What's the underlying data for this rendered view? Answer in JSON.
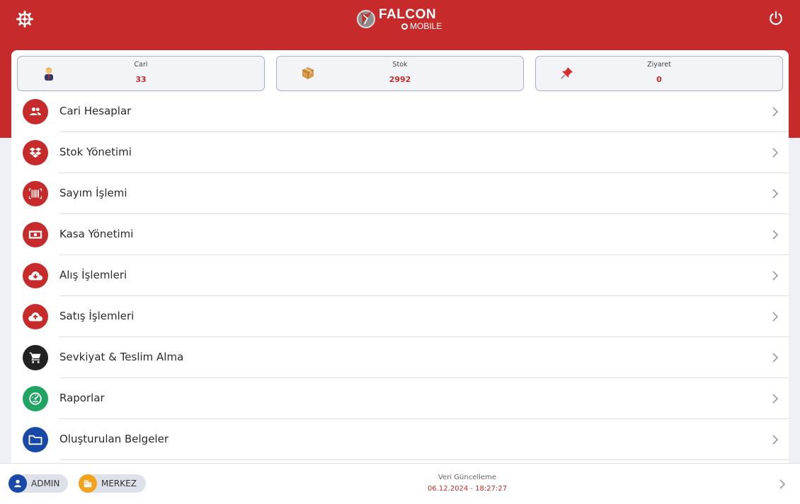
{
  "header": {
    "logo_text": "FALCON",
    "logo_subtext": "MOBILE",
    "settings_icon": "gear-icon",
    "power_icon": "power-icon"
  },
  "stats": [
    {
      "label": "Cari",
      "value": "33",
      "icon": "person-icon"
    },
    {
      "label": "Stok",
      "value": "2992",
      "icon": "package-icon"
    },
    {
      "label": "Ziyaret",
      "value": "0",
      "icon": "pushpin-icon"
    }
  ],
  "menu": {
    "items": [
      {
        "label": "Cari Hesaplar",
        "icon": "people-icon",
        "color": "#c62a2a"
      },
      {
        "label": "Stok Yönetimi",
        "icon": "dropbox-icon",
        "color": "#c62a2a"
      },
      {
        "label": "Sayım İşlemi",
        "icon": "barcode-icon",
        "color": "#c62a2a"
      },
      {
        "label": "Kasa Yönetimi",
        "icon": "money-icon",
        "color": "#c62a2a"
      },
      {
        "label": "Alış İşlemleri",
        "icon": "cloud-download-icon",
        "color": "#c62a2a"
      },
      {
        "label": "Satış İşlemleri",
        "icon": "cloud-upload-icon",
        "color": "#c62a2a"
      },
      {
        "label": "Sevkiyat & Teslim Alma",
        "icon": "cart-icon",
        "color": "#222222"
      },
      {
        "label": "Raporlar",
        "icon": "speedometer-icon",
        "color": "#1fa463"
      },
      {
        "label": "Oluşturulan Belgeler",
        "icon": "folder-icon",
        "color": "#1849a9"
      }
    ]
  },
  "footer": {
    "user_label": "ADMIN",
    "branch_label": "MERKEZ",
    "update_label": "Veri Güncelleme",
    "update_value": "06.12.2024 - 18:27:27"
  },
  "colors": {
    "brand": "#c62a2a",
    "user_chip": "#1849a9",
    "branch_chip": "#f4a11b"
  }
}
